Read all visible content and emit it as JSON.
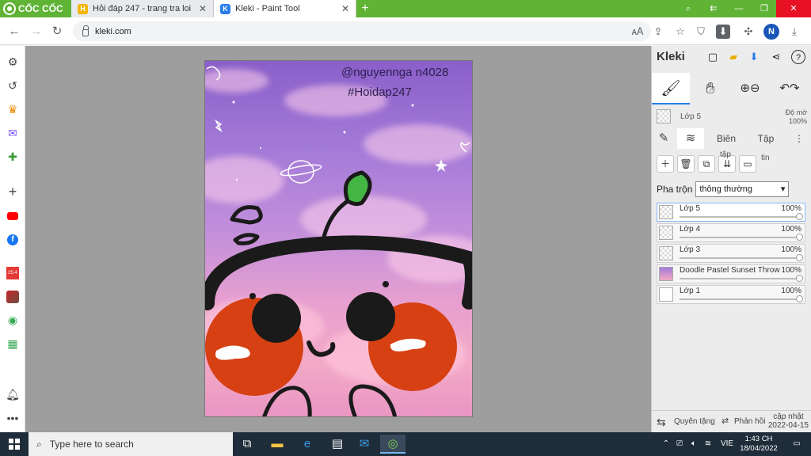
{
  "browser": {
    "brand": "CỐC CỐC",
    "tabs": [
      {
        "title": "Hỏi đáp 247 - trang tra loi",
        "favicon": "hoidap-favicon",
        "active": false
      },
      {
        "title": "Kleki - Paint Tool",
        "favicon": "kleki-favicon",
        "active": true
      }
    ],
    "new_tab": "+",
    "url": "kleki.com",
    "profile_initial": "N",
    "colors": {
      "tabstrip": "#5fb335",
      "accent": "#1a56b8"
    }
  },
  "sidebar": {
    "icons": [
      "settings-icon",
      "history-icon",
      "crown-icon",
      "messenger-icon",
      "game-controller-icon",
      "plus-icon",
      "youtube-icon",
      "facebook-icon",
      "calendar-icon",
      "game-icon",
      "maps-icon",
      "sheet-icon",
      "bell-icon",
      "more-icon"
    ],
    "calendar_label": "25.4"
  },
  "canvas": {
    "watermark_user": "@nguyennga n4028",
    "watermark_tag": "#Hoidap247"
  },
  "kleki": {
    "brand": "Kleki",
    "current_layer": {
      "name": "Lớp 5",
      "opacity_label": "Độ mờ",
      "opacity": "100%"
    },
    "tabs": [
      "Biên",
      "Tập"
    ],
    "tab_overflow": "⋮",
    "action_labels": {
      "tap": "tập",
      "tin": "tin"
    },
    "blend_label": "Pha trộn",
    "blend_value": "thông thường",
    "layers": [
      {
        "name": "Lớp 5",
        "opacity": "100%",
        "selected": true
      },
      {
        "name": "Lớp 4",
        "opacity": "100%",
        "selected": false
      },
      {
        "name": "Lớp 3",
        "opacity": "100%",
        "selected": false
      },
      {
        "name": "Doodle Pastel Sunset Throw P",
        "opacity": "100%",
        "selected": false
      },
      {
        "name": "Lớp 1",
        "opacity": "100%",
        "selected": false
      }
    ],
    "footer": {
      "swap": "⇆",
      "undo_label": "Quyên tặng",
      "redo_label": "Phản hồi",
      "update_label": "cập nhật",
      "update_date": "2022-04-15"
    }
  },
  "taskbar": {
    "search_placeholder": "Type here to search",
    "language": "VIE",
    "time": "1:43 CH",
    "date": "18/04/2022"
  }
}
